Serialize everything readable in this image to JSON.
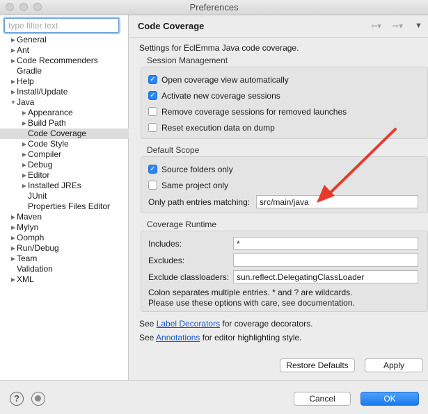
{
  "window": {
    "title": "Preferences"
  },
  "filter": {
    "placeholder": "type filter text"
  },
  "tree": [
    {
      "label": "General",
      "level": 0,
      "twisty": "collapsed"
    },
    {
      "label": "Ant",
      "level": 0,
      "twisty": "collapsed"
    },
    {
      "label": "Code Recommenders",
      "level": 0,
      "twisty": "collapsed"
    },
    {
      "label": "Gradle",
      "level": 0,
      "twisty": "none"
    },
    {
      "label": "Help",
      "level": 0,
      "twisty": "collapsed"
    },
    {
      "label": "Install/Update",
      "level": 0,
      "twisty": "collapsed"
    },
    {
      "label": "Java",
      "level": 0,
      "twisty": "expanded"
    },
    {
      "label": "Appearance",
      "level": 1,
      "twisty": "collapsed"
    },
    {
      "label": "Build Path",
      "level": 1,
      "twisty": "collapsed"
    },
    {
      "label": "Code Coverage",
      "level": 1,
      "twisty": "none",
      "selected": true
    },
    {
      "label": "Code Style",
      "level": 1,
      "twisty": "collapsed"
    },
    {
      "label": "Compiler",
      "level": 1,
      "twisty": "collapsed"
    },
    {
      "label": "Debug",
      "level": 1,
      "twisty": "collapsed"
    },
    {
      "label": "Editor",
      "level": 1,
      "twisty": "collapsed"
    },
    {
      "label": "Installed JREs",
      "level": 1,
      "twisty": "collapsed"
    },
    {
      "label": "JUnit",
      "level": 1,
      "twisty": "none"
    },
    {
      "label": "Properties Files Editor",
      "level": 1,
      "twisty": "none"
    },
    {
      "label": "Maven",
      "level": 0,
      "twisty": "collapsed"
    },
    {
      "label": "Mylyn",
      "level": 0,
      "twisty": "collapsed"
    },
    {
      "label": "Oomph",
      "level": 0,
      "twisty": "collapsed"
    },
    {
      "label": "Run/Debug",
      "level": 0,
      "twisty": "collapsed"
    },
    {
      "label": "Team",
      "level": 0,
      "twisty": "collapsed"
    },
    {
      "label": "Validation",
      "level": 0,
      "twisty": "none"
    },
    {
      "label": "XML",
      "level": 0,
      "twisty": "collapsed"
    }
  ],
  "page": {
    "title": "Code Coverage",
    "description": "Settings for EclEmma Java code coverage."
  },
  "session": {
    "title": "Session Management",
    "options": [
      {
        "label": "Open coverage view automatically",
        "checked": true
      },
      {
        "label": "Activate new coverage sessions",
        "checked": true
      },
      {
        "label": "Remove coverage sessions for removed launches",
        "checked": false
      },
      {
        "label": "Reset execution data on dump",
        "checked": false
      }
    ]
  },
  "scope": {
    "title": "Default Scope",
    "options": [
      {
        "label": "Source folders only",
        "checked": true
      },
      {
        "label": "Same project only",
        "checked": false
      }
    ],
    "path_label": "Only path entries matching:",
    "path_value": "src/main/java"
  },
  "runtime": {
    "title": "Coverage Runtime",
    "includes_label": "Includes:",
    "includes_value": "*",
    "excludes_label": "Excludes:",
    "excludes_value": "",
    "classloaders_label": "Exclude classloaders:",
    "classloaders_value": "sun.reflect.DelegatingClassLoader",
    "note1": "Colon separates multiple entries. * and ? are wildcards.",
    "note2": "Please use these options with care, see documentation."
  },
  "links": {
    "line1_prefix": "See ",
    "line1_link": "Label Decorators",
    "line1_suffix": " for coverage decorators.",
    "line2_prefix": "See ",
    "line2_link": "Annotations",
    "line2_suffix": " for editor highlighting style."
  },
  "buttons": {
    "restore_defaults": "Restore Defaults",
    "apply": "Apply",
    "cancel": "Cancel",
    "ok": "OK"
  },
  "icons": {
    "help": "?",
    "check": "✓",
    "twisty_collapsed": "▶",
    "twisty_expanded": "▼",
    "nav_back": "⇦▾",
    "nav_forward": "⇨▾",
    "view_menu": "▼"
  },
  "colors": {
    "accent": "#2c83f4",
    "annotation_arrow": "#e8392d",
    "link": "#1a55c8"
  }
}
